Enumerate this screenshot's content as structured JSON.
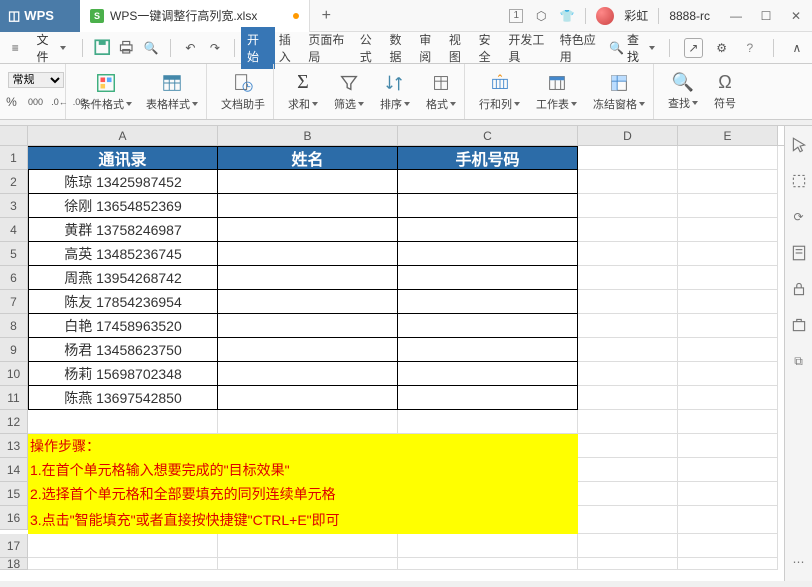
{
  "app": {
    "logo": "WPS"
  },
  "tab": {
    "title": "WPS一键调整行高列宽.xlsx"
  },
  "user": {
    "name": "彩虹",
    "id": "8888-rc"
  },
  "menubar": {
    "file": "文件",
    "tabs": [
      "开始",
      "插入",
      "页面布局",
      "公式",
      "数据",
      "审阅",
      "视图",
      "安全",
      "开发工具",
      "特色应用"
    ],
    "search": "查找"
  },
  "ribbon": {
    "numfmt": "常规",
    "buttons": {
      "condfmt": "条件格式",
      "tablestyle": "表格样式",
      "dochelper": "文档助手",
      "sum": "求和",
      "filter": "筛选",
      "sort": "排序",
      "format": "格式",
      "rowcol": "行和列",
      "worksheet": "工作表",
      "freeze": "冻结窗格",
      "find": "查找",
      "symbol": "符号"
    }
  },
  "columns": [
    "A",
    "B",
    "C",
    "D",
    "E"
  ],
  "header_row": [
    "通讯录",
    "姓名",
    "手机号码"
  ],
  "data_rows": [
    "陈琼 13425987452",
    "徐刚 13654852369",
    "黄群 13758246987",
    "高英 13485236745",
    "周燕 13954268742",
    "陈友 17854236954",
    "白艳 17458963520",
    "杨君 13458623750",
    "杨莉 15698702348",
    "陈燕 13697542850"
  ],
  "instructions": {
    "title": "操作步骤：",
    "s1": "1.在首个单元格输入想要完成的\"目标效果\"",
    "s2": "2.选择首个单元格和全部要填充的同列连续单元格",
    "s3": "3.点击\"智能填充\"或者直接按快捷键\"CTRL+E\"即可"
  },
  "winbox": "1"
}
